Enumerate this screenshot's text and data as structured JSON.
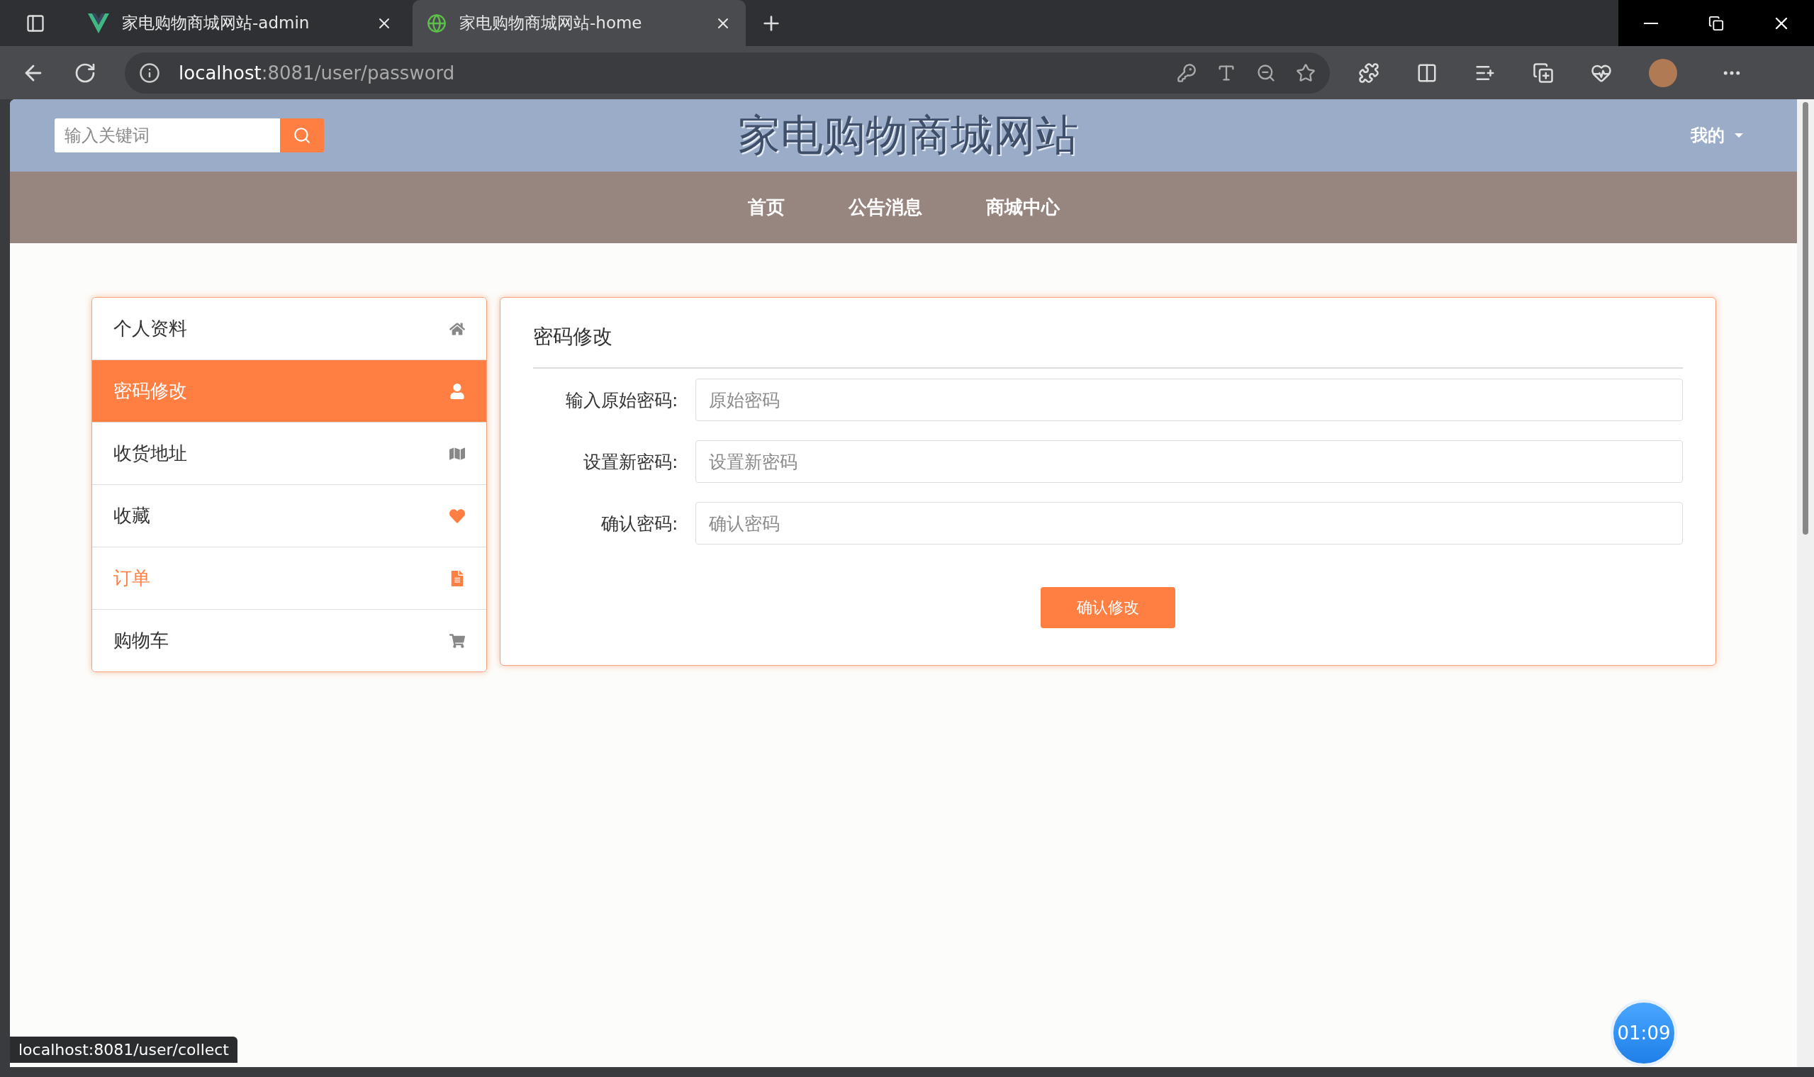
{
  "browser": {
    "tabs": [
      {
        "title": "家电购物商城网站-admin",
        "kind": "vue",
        "selected": false
      },
      {
        "title": "家电购物商城网站-home",
        "kind": "globe",
        "selected": true
      }
    ],
    "url": {
      "host": "localhost",
      "path": ":8081/user/password"
    }
  },
  "header": {
    "search": {
      "placeholder": "输入关键词"
    },
    "site_title": "家电购物商城网站",
    "user_menu": "我的"
  },
  "nav": [
    {
      "label": "首页"
    },
    {
      "label": "公告消息"
    },
    {
      "label": "商城中心"
    }
  ],
  "sidebar": [
    {
      "label": "个人资料",
      "kind": "home",
      "color": "#888888",
      "selected": false,
      "hovered": false
    },
    {
      "label": "密码修改",
      "kind": "user",
      "color": "#ffffff",
      "selected": true,
      "hovered": false
    },
    {
      "label": "收货地址",
      "kind": "map",
      "color": "#888888",
      "selected": false,
      "hovered": false
    },
    {
      "label": "收藏",
      "kind": "heart",
      "color": "#ff7f42",
      "selected": false,
      "hovered": false
    },
    {
      "label": "订单",
      "kind": "file",
      "color": "#ff7f42",
      "selected": false,
      "hovered": true
    },
    {
      "label": "购物车",
      "kind": "cart",
      "color": "#888888",
      "selected": false,
      "hovered": false
    }
  ],
  "form": {
    "title": "密码修改",
    "fields": [
      {
        "label": "输入原始密码:",
        "placeholder": "原始密码"
      },
      {
        "label": "设置新密码:",
        "placeholder": "设置新密码"
      },
      {
        "label": "确认密码:",
        "placeholder": "确认密码"
      }
    ],
    "submit": "确认修改"
  },
  "status_url": "localhost:8081/user/collect",
  "timer": "01:09"
}
